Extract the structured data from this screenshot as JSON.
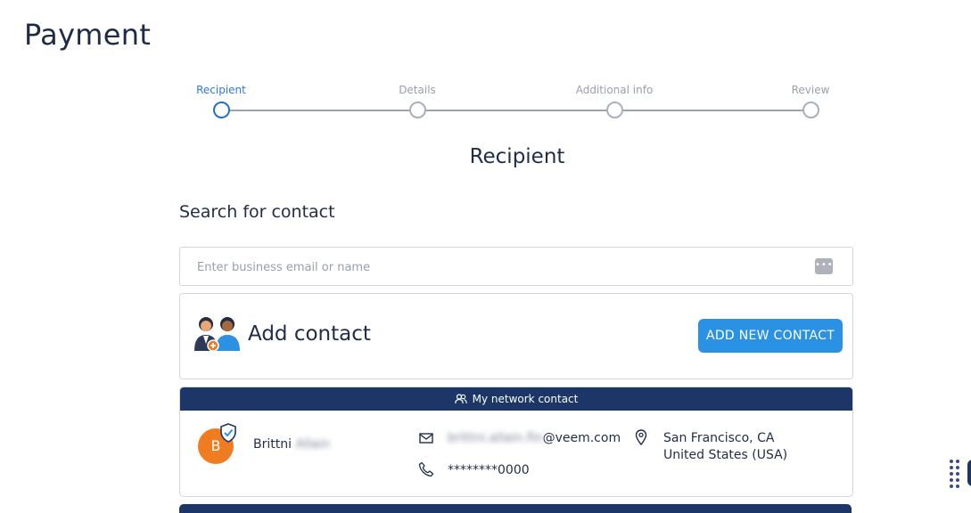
{
  "page": {
    "title": "Payment"
  },
  "stepper": {
    "steps": [
      {
        "label": "Recipient",
        "active": true
      },
      {
        "label": "Details",
        "active": false
      },
      {
        "label": "Additional info",
        "active": false
      },
      {
        "label": "Review",
        "active": false
      }
    ]
  },
  "section": {
    "title": "Recipient"
  },
  "search": {
    "label": "Search for contact",
    "value": "",
    "placeholder": "Enter business email or name",
    "icon": "more-dots-icon"
  },
  "add_contact": {
    "title": "Add contact",
    "button_label": "ADD NEW CONTACT",
    "icon": "people-add-icon"
  },
  "contact": {
    "banner_label": "My network contact",
    "avatar_initial": "B",
    "first_name": "Brittni",
    "last_name_blurred": "Allain",
    "email_local_blurred": "brittni.allain.fin",
    "email_domain": "@veem.com",
    "phone": "********0000",
    "city": "San Francisco, CA",
    "country": "United States (USA)"
  },
  "colors": {
    "accent": "#2b91e3",
    "active_step": "#1f6fd0",
    "banner": "#1c3667",
    "avatar": "#f07c22",
    "text": "#1f2d47"
  }
}
